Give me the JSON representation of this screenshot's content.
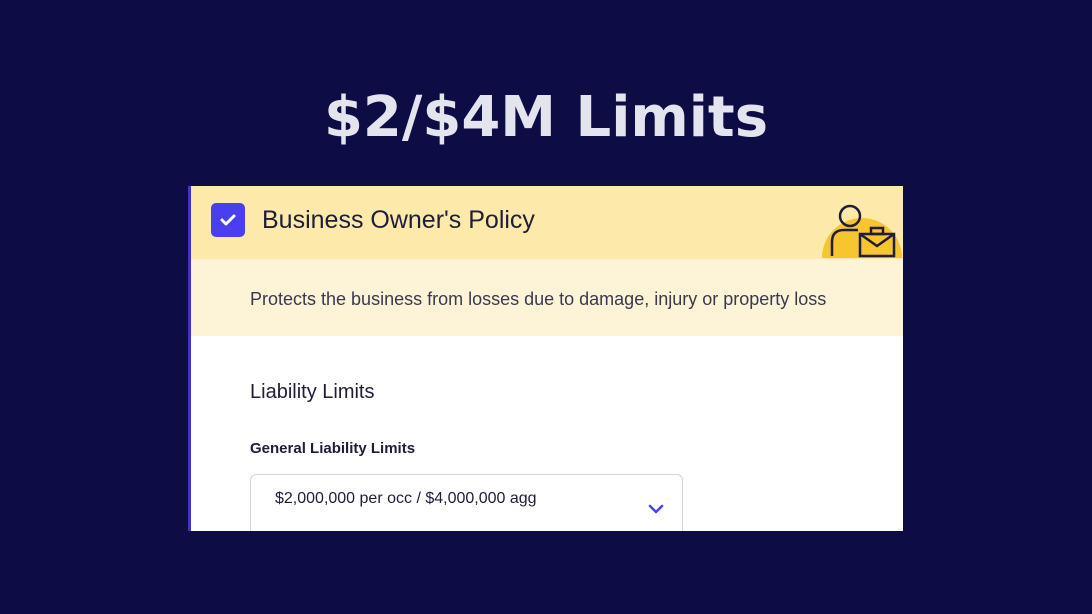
{
  "headline": "$2/$4M Limits",
  "card": {
    "checked": true,
    "title": "Business Owner's Policy",
    "description": "Protects the business from losses due to damage, injury or property loss",
    "icon": "business-owner-icon",
    "section_title": "Liability Limits",
    "field_label": "General Liability Limits",
    "select_value": "$2,000,000 per occ / $4,000,000 agg"
  },
  "colors": {
    "background": "#0d0c45",
    "header": "#fde9a9",
    "description_band": "#fdf3d6",
    "checkbox": "#4a3ff0",
    "chevron": "#4a3ff0"
  }
}
